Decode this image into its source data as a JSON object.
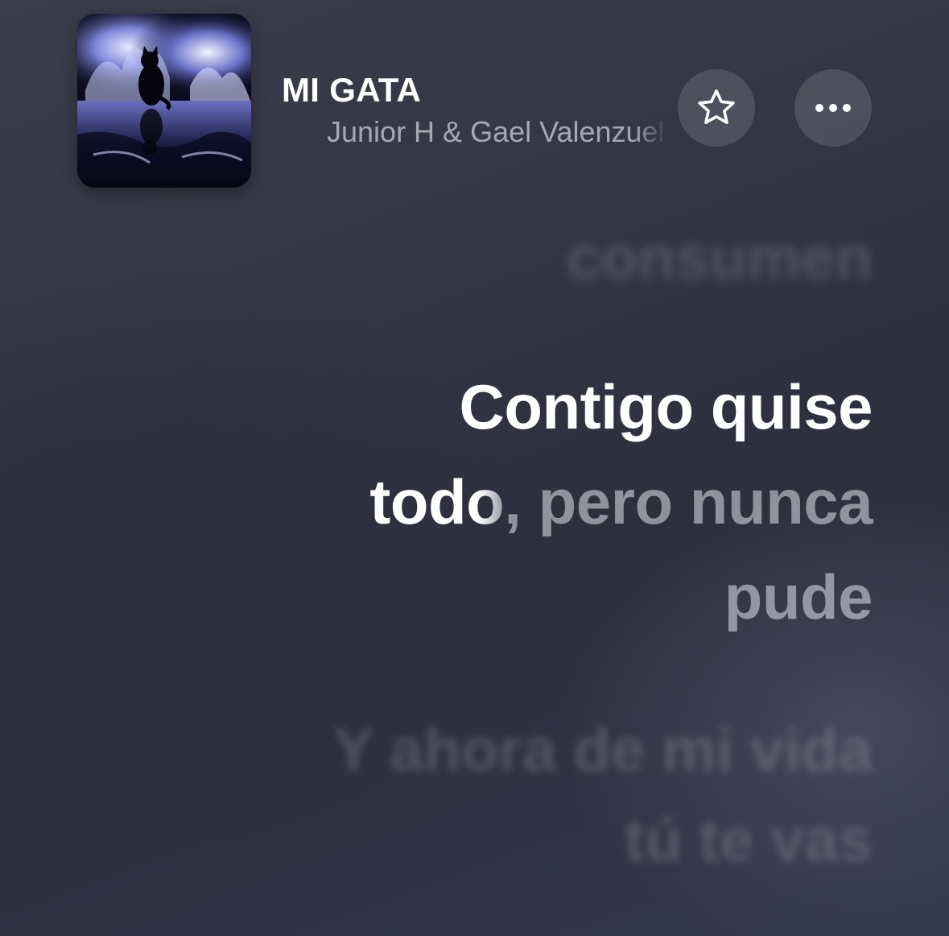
{
  "now_playing": {
    "title": "MI GATA",
    "artist": "Junior H & Gael Valenzuela",
    "artwork_icon": "album-artwork-black-cat-fire"
  },
  "actions": {
    "favorite_icon": "star-outline-icon",
    "more_icon": "ellipsis-icon"
  },
  "lyrics": {
    "previous_line": "consumen",
    "current_line": {
      "line1": "Contigo quise",
      "line2_sung": "tod",
      "line2_partial": "o",
      "line2_unsung": ", pero nunca",
      "line3": "pude"
    },
    "next_line": {
      "line1": "Y ahora de mi vida",
      "line2": "tú te vas"
    }
  },
  "colors": {
    "background": "#333545",
    "sung_text": "#ffffff",
    "unsung_text": "rgba(235,235,245,0.52)"
  }
}
